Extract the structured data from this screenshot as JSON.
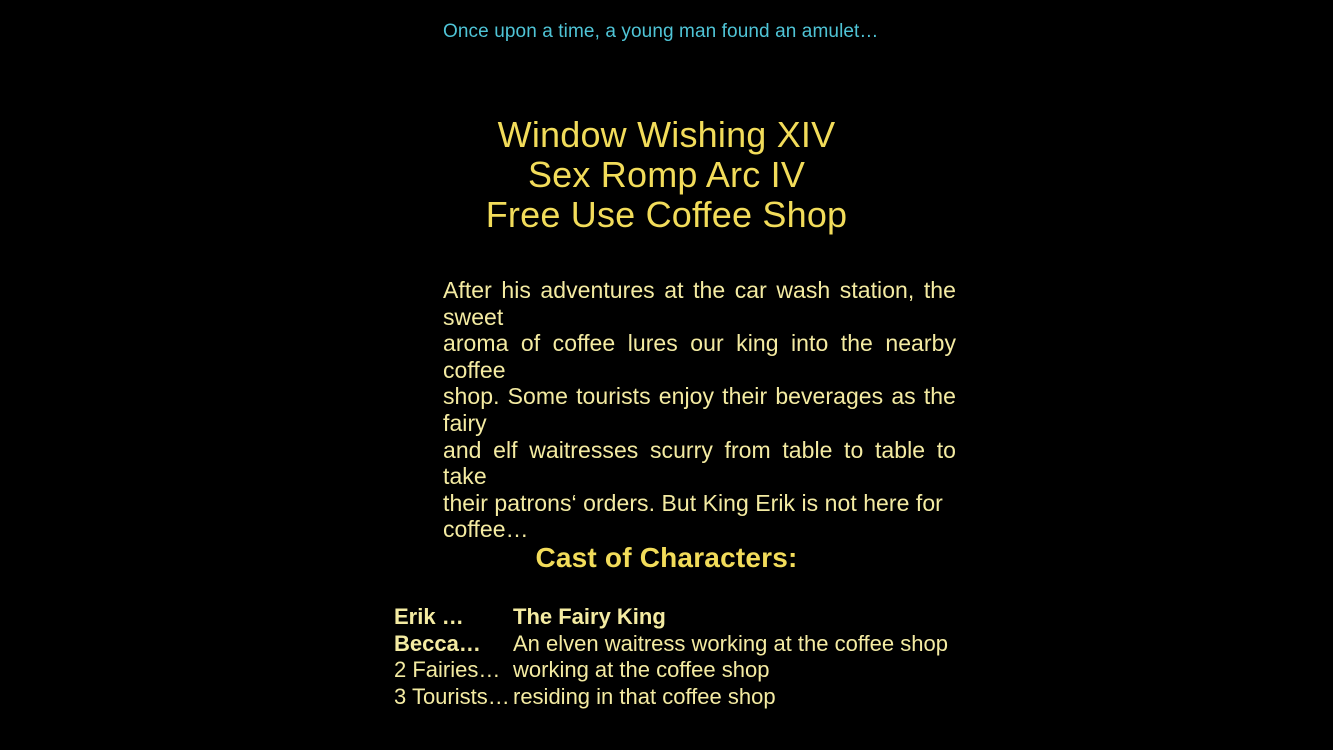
{
  "colors": {
    "background": "#000000",
    "tagline": "#4FC4D6",
    "title": "#F2DC5A",
    "body": "#F4EBA2",
    "heading": "#F2DC5A"
  },
  "tagline": "Once upon a time, a young man found an amulet…",
  "title": {
    "line1": "Window Wishing XIV",
    "line2": "Sex Romp Arc IV",
    "line3": "Free Use Coffee Shop"
  },
  "synopsis": {
    "line1": "After his adventures at the car wash station, the sweet",
    "line2": "aroma of coffee lures our king into the nearby coffee",
    "line3": "shop. Some tourists enjoy their beverages as the fairy",
    "line4": "and elf waitresses scurry from table to table to take",
    "line5": "their patrons‘ orders. But King Erik is not here for",
    "line6": "coffee…"
  },
  "cast": {
    "heading": "Cast of Characters:",
    "rows": [
      {
        "name": "Erik …",
        "desc": "The Fairy King",
        "name_bold": true,
        "desc_bold": true
      },
      {
        "name": "Becca…",
        "desc": "An elven waitress working at the coffee shop",
        "name_bold": true,
        "desc_bold": false
      },
      {
        "name": "2 Fairies…",
        "desc": "working at the coffee shop",
        "name_bold": false,
        "desc_bold": false
      },
      {
        "name": "3 Tourists…",
        "desc": "residing in that coffee shop",
        "name_bold": false,
        "desc_bold": false
      }
    ]
  }
}
